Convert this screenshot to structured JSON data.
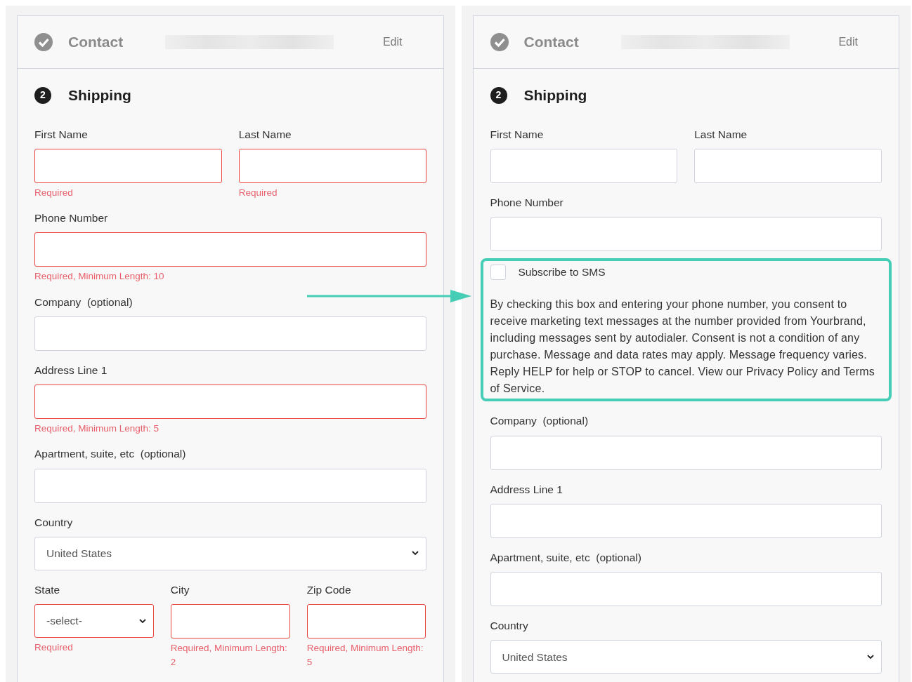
{
  "panels": [
    {
      "contact": {
        "title": "Contact",
        "edit": "Edit"
      },
      "shipping": {
        "step": "2",
        "title": "Shipping"
      },
      "rows": [
        {
          "kind": "fields",
          "fields": [
            {
              "label": "First Name",
              "kind": "input",
              "invalid": true,
              "error": "Required"
            },
            {
              "label": "Last Name",
              "kind": "input",
              "invalid": true,
              "error": "Required"
            }
          ]
        },
        {
          "kind": "fields",
          "fields": [
            {
              "label": "Phone Number",
              "kind": "input",
              "invalid": true,
              "error": "Required, Minimum Length: 10"
            }
          ]
        },
        {
          "kind": "fields",
          "fields": [
            {
              "label": "Company  (optional)",
              "kind": "input",
              "invalid": false
            }
          ]
        },
        {
          "kind": "fields",
          "fields": [
            {
              "label": "Address Line 1",
              "kind": "input",
              "invalid": true,
              "error": "Required, Minimum Length: 5"
            }
          ]
        },
        {
          "kind": "fields",
          "fields": [
            {
              "label": "Apartment, suite, etc  (optional)",
              "kind": "input",
              "invalid": false
            }
          ]
        },
        {
          "kind": "fields",
          "fields": [
            {
              "label": "Country",
              "kind": "select",
              "value": "United States",
              "invalid": false
            }
          ]
        },
        {
          "kind": "fields",
          "fields": [
            {
              "label": "State",
              "kind": "select",
              "value": "-select-",
              "invalid": true,
              "error": "Required"
            },
            {
              "label": "City",
              "kind": "input",
              "invalid": true,
              "error": "Required, Minimum Length: 2"
            },
            {
              "label": "Zip Code",
              "kind": "input",
              "invalid": true,
              "error": "Required, Minimum Length: 5"
            }
          ]
        }
      ]
    },
    {
      "contact": {
        "title": "Contact",
        "edit": "Edit"
      },
      "shipping": {
        "step": "2",
        "title": "Shipping"
      },
      "rows": [
        {
          "kind": "fields",
          "fields": [
            {
              "label": "First Name",
              "kind": "input",
              "invalid": false
            },
            {
              "label": "Last Name",
              "kind": "input",
              "invalid": false
            }
          ]
        },
        {
          "kind": "fields",
          "fields": [
            {
              "label": "Phone Number",
              "kind": "input",
              "invalid": false
            }
          ]
        },
        {
          "kind": "sms",
          "label": "Subscribe to SMS",
          "checked": false,
          "highlighted": true,
          "text": "By checking this box and entering your phone number, you consent to receive marketing text messages at the number provided from Yourbrand, including messages sent by autodialer. Consent is not a condition of any purchase. Message and data rates may apply. Message frequency varies. Reply HELP for help or STOP to cancel. View our Privacy Policy and Terms of Service."
        },
        {
          "kind": "fields",
          "fields": [
            {
              "label": "Company  (optional)",
              "kind": "input",
              "invalid": false
            }
          ]
        },
        {
          "kind": "fields",
          "fields": [
            {
              "label": "Address Line 1",
              "kind": "input",
              "invalid": false
            }
          ]
        },
        {
          "kind": "fields",
          "fields": [
            {
              "label": "Apartment, suite, etc  (optional)",
              "kind": "input",
              "invalid": false
            }
          ]
        },
        {
          "kind": "fields",
          "fields": [
            {
              "label": "Country",
              "kind": "select",
              "value": "United States",
              "invalid": false
            }
          ]
        }
      ]
    }
  ]
}
